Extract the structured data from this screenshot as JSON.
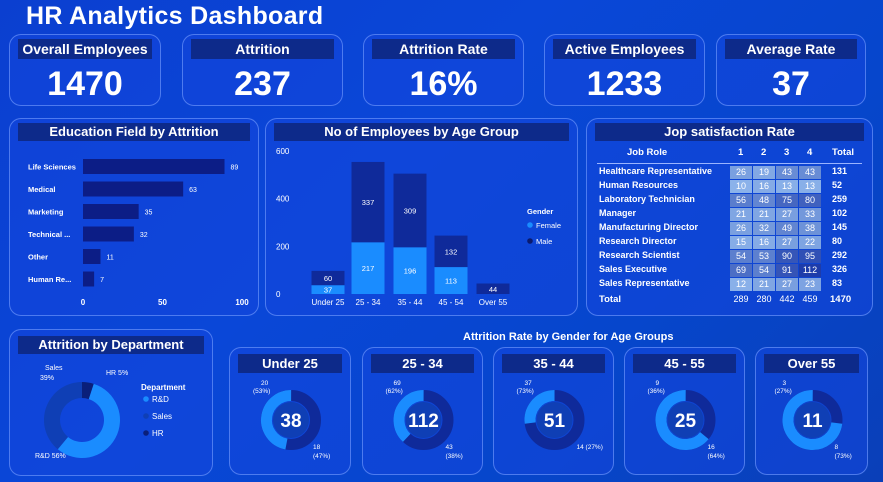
{
  "title": "HR Analytics Dashboard",
  "kpis": [
    {
      "label": "Overall Employees",
      "value": "1470"
    },
    {
      "label": "Attrition",
      "value": "237"
    },
    {
      "label": "Attrition Rate",
      "value": "16%"
    },
    {
      "label": "Active Employees",
      "value": "1233"
    },
    {
      "label": "Average Rate",
      "value": "37"
    }
  ],
  "education": {
    "title": "Education Field by Attrition",
    "categories": [
      "Life Sciences",
      "Medical",
      "Marketing",
      "Technical ...",
      "Other",
      "Human Re..."
    ],
    "values": [
      89,
      63,
      35,
      32,
      11,
      7
    ],
    "ticks": [
      "0",
      "50",
      "100"
    ],
    "xlim": [
      0,
      100
    ]
  },
  "age_group": {
    "title": "No of Employees by Age Group",
    "categories": [
      "Under 25",
      "25 - 34",
      "35 - 44",
      "45 - 54",
      "Over 55"
    ],
    "female": [
      37,
      217,
      196,
      113,
      0
    ],
    "male": [
      60,
      337,
      309,
      132,
      44
    ],
    "ticks": [
      "600",
      "400",
      "200",
      "0"
    ],
    "legend_title": "Gender",
    "legend": [
      "Female",
      "Male"
    ]
  },
  "job_sat": {
    "title": "Jop satisfaction Rate",
    "headers": [
      "Job Role",
      "1",
      "2",
      "3",
      "4",
      "Total"
    ],
    "rows": [
      [
        "Healthcare Representative",
        "26",
        "19",
        "43",
        "43",
        "131"
      ],
      [
        "Human Resources",
        "10",
        "16",
        "13",
        "13",
        "52"
      ],
      [
        "Laboratory Technician",
        "56",
        "48",
        "75",
        "80",
        "259"
      ],
      [
        "Manager",
        "21",
        "21",
        "27",
        "33",
        "102"
      ],
      [
        "Manufacturing Director",
        "26",
        "32",
        "49",
        "38",
        "145"
      ],
      [
        "Research Director",
        "15",
        "16",
        "27",
        "22",
        "80"
      ],
      [
        "Research Scientist",
        "54",
        "53",
        "90",
        "95",
        "292"
      ],
      [
        "Sales Executive",
        "69",
        "54",
        "91",
        "112",
        "326"
      ],
      [
        "Sales Representative",
        "12",
        "21",
        "27",
        "23",
        "83"
      ]
    ],
    "total_row": [
      "Total",
      "289",
      "280",
      "442",
      "459",
      "1470"
    ]
  },
  "department": {
    "title": "Attrition by Department",
    "legend_title": "Department",
    "legend": [
      "R&D",
      "Sales",
      "HR"
    ],
    "slices": [
      {
        "name": "R&D",
        "pct": 56,
        "label": "R&D 56%",
        "color": "#1a8cff"
      },
      {
        "name": "Sales",
        "pct": 39,
        "label_line1": "Sales",
        "label_line2": "39%",
        "color": "#0f3fb5"
      },
      {
        "name": "HR",
        "pct": 5,
        "label": "HR 5%",
        "color": "#0a1f7a"
      }
    ]
  },
  "gender_age": {
    "title": "Attrition Rate by Gender for Age Groups",
    "groups": [
      {
        "name": "Under 25",
        "total": "38",
        "a_val": "20",
        "a_pct": "(53%)",
        "b_val": "18",
        "b_pct": "(47%)",
        "a_frac": 0.53
      },
      {
        "name": "25 - 34",
        "total": "112",
        "a_val": "69",
        "a_pct": "(62%)",
        "b_val": "43",
        "b_pct": "(38%)",
        "a_frac": 0.62
      },
      {
        "name": "35 - 44",
        "total": "51",
        "a_val": "37",
        "a_pct": "(73%)",
        "b_val": "14 (27%)",
        "b_pct": "",
        "a_frac": 0.73
      },
      {
        "name": "45 - 55",
        "total": "25",
        "a_val": "9",
        "a_pct": "(36%)",
        "b_val": "16",
        "b_pct": "(64%)",
        "a_frac": 0.36
      },
      {
        "name": "Over 55",
        "total": "11",
        "a_val": "3",
        "a_pct": "(27%)",
        "b_val": "8",
        "b_pct": "(73%)",
        "a_frac": 0.27
      }
    ]
  },
  "colors": {
    "female": "#1a8cff",
    "male": "#0f2a9a",
    "dark_head": "#0d2a8a"
  }
}
